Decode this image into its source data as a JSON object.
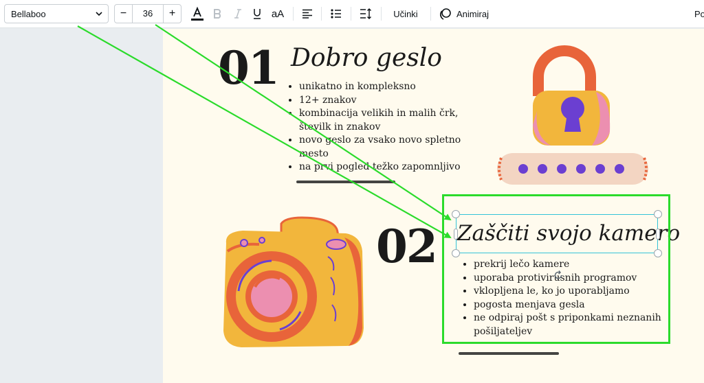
{
  "toolbar": {
    "font_family": "Bellaboo",
    "font_size": "36",
    "minus_label": "−",
    "plus_label": "+",
    "case_label": "aA",
    "effects_label": "Učinki",
    "animate_label": "Animiraj",
    "position_label": "Po"
  },
  "page": {
    "section1": {
      "number": "01",
      "title": "Dobro geslo",
      "bullets": [
        "unikatno in kompleksno",
        "12+ znakov",
        "kombinacija velikih in malih črk, številk in znakov",
        "novo geslo za vsako novo spletno mesto",
        "na prvi pogled težko zapomnljivo"
      ]
    },
    "section2": {
      "number": "02",
      "title": "Zaščiti svojo kamero",
      "bullets": [
        "prekrij lečo kamere",
        "uporaba protivirusnih programov",
        "vklopljena le, ko jo uporabljamo",
        "pogosta menjava gesla",
        "ne odpiraj pošt s priponkami neznanih pošiljateljev"
      ]
    }
  },
  "colors": {
    "highlight": "#2bdb2b",
    "selection": "#33c3d8",
    "canvas": "#fffbee",
    "workspace": "#e9edf0"
  }
}
